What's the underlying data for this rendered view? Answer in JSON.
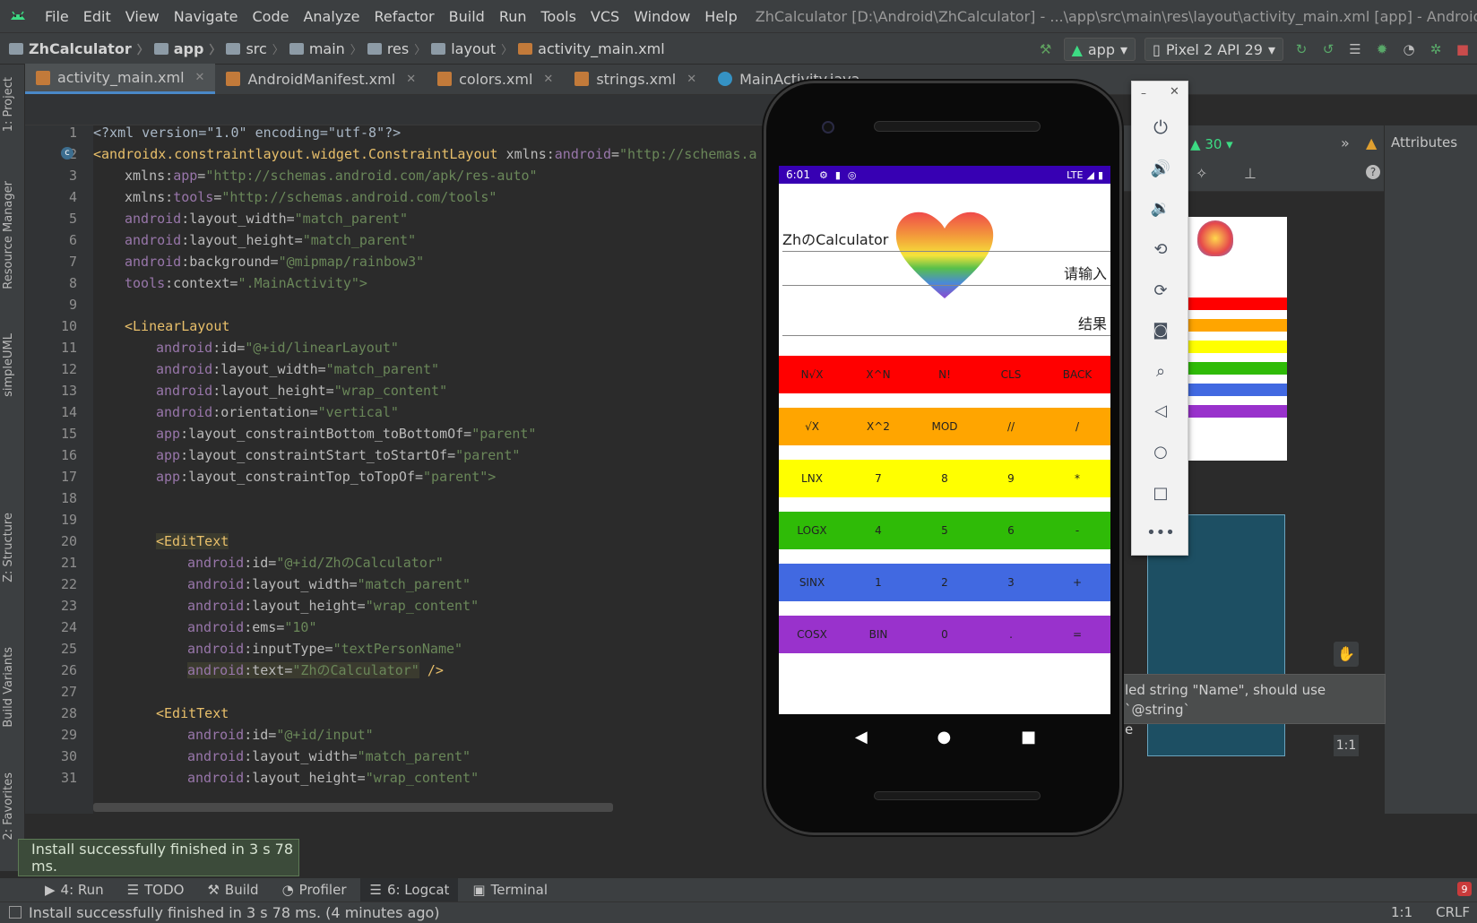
{
  "window": {
    "title": "ZhCalculator [D:\\Android\\ZhCalculator] - ...\\app\\src\\main\\res\\layout\\activity_main.xml [app] - Android Studio",
    "menu": [
      "File",
      "Edit",
      "View",
      "Navigate",
      "Code",
      "Analyze",
      "Refactor",
      "Build",
      "Run",
      "Tools",
      "VCS",
      "Window",
      "Help"
    ]
  },
  "breadcrumb": [
    "ZhCalculator",
    "app",
    "src",
    "main",
    "res",
    "layout",
    "activity_main.xml"
  ],
  "toolbar": {
    "config": "app",
    "device": "Pixel 2 API 29"
  },
  "left_tabs": [
    "1: Project",
    "Resource Manager",
    "simpleUML",
    "Z: Structure",
    "Build Variants",
    "2: Favorites"
  ],
  "tabs": [
    "activity_main.xml",
    "AndroidManifest.xml",
    "colors.xml",
    "strings.xml",
    "MainActivity.java"
  ],
  "design": {
    "api": "30",
    "attributes": "Attributes",
    "ratio": "1:1"
  },
  "tooltip": {
    "line1": "led string \"Name\", should use `@string`",
    "line2": "e"
  },
  "code": {
    "line_numbers": [
      "1",
      "2",
      "3",
      "4",
      "5",
      "6",
      "7",
      "8",
      "9",
      "10",
      "11",
      "12",
      "13",
      "14",
      "15",
      "16",
      "17",
      "18",
      "19",
      "20",
      "21",
      "22",
      "23",
      "24",
      "25",
      "26",
      "27",
      "28",
      "29",
      "30",
      "31"
    ],
    "l1": "<?xml version=\"1.0\" encoding=\"utf-8\"?>",
    "l2a": "<androidx.constraintlayout.widget.ConstraintLayout",
    "l2b": " xmlns:",
    "l2c": "android",
    "l2d": "=",
    "l2e": "\"http://schemas.a",
    "l3a": "xmlns:",
    "l3b": "app",
    "l3c": "=",
    "l3d": "\"http://schemas.android.com/apk/res-auto\"",
    "l4a": "xmlns:",
    "l4b": "tools",
    "l4c": "=",
    "l4d": "\"http://schemas.android.com/tools\"",
    "android": "android",
    "app": "app",
    "tools": "tools",
    "l5a": ":layout_width=",
    "l5b": "\"match_parent\"",
    "l6a": ":layout_height=",
    "l6b": "\"match_parent\"",
    "l7a": ":background=",
    "l7b": "\"@mipmap/rainbow3\"",
    "l8a": ":context=",
    "l8b": "\".MainActivity\">",
    "l10": "<LinearLayout",
    "l11a": ":id=",
    "l11b": "\"@+id/linearLayout\"",
    "l12a": ":layout_width=",
    "l12b": "\"match_parent\"",
    "l13a": ":layout_height=",
    "l13b": "\"wrap_content\"",
    "l14a": ":orientation=",
    "l14b": "\"vertical\"",
    "l15a": ":layout_constraintBottom_toBottomOf=",
    "l15b": "\"parent\"",
    "l16a": ":layout_constraintStart_toStartOf=",
    "l16b": "\"parent\"",
    "l17a": ":layout_constraintTop_toTopOf=",
    "l17b": "\"parent\">",
    "l20": "<EditText",
    "l21a": ":id=",
    "l21b": "\"@+id/ZhのCalculator\"",
    "l22a": ":layout_width=",
    "l22b": "\"match_parent\"",
    "l23a": ":layout_height=",
    "l23b": "\"wrap_content\"",
    "l24a": ":ems=",
    "l24b": "\"10\"",
    "l25a": ":inputType=",
    "l25b": "\"textPersonName\"",
    "l26a": ":text=",
    "l26b": "\"ZhのCalculator\"",
    "l26c": " />",
    "l28": "<EditText",
    "l29a": ":id=",
    "l29b": "\"@+id/input\"",
    "l30a": ":layout_width=",
    "l30b": "\"match_parent\"",
    "l31a": ":layout_height=",
    "l31b": "\"wrap_content\""
  },
  "phone": {
    "time": "6:01",
    "network": "LTE",
    "title_field": "ZhのCalculator",
    "input_hint": "请输入",
    "result": "结果",
    "rows": [
      {
        "color": "#ff0000",
        "keys": [
          "N√X",
          "X^N",
          "N!",
          "CLS",
          "BACK"
        ]
      },
      {
        "color": "#ffa500",
        "keys": [
          "√X",
          "X^2",
          "MOD",
          "//",
          "/"
        ]
      },
      {
        "color": "#ffff00",
        "keys": [
          "LNX",
          "7",
          "8",
          "9",
          "*"
        ]
      },
      {
        "color": "#2fbb07",
        "keys": [
          "LOGX",
          "4",
          "5",
          "6",
          "-"
        ]
      },
      {
        "color": "#4169e1",
        "keys": [
          "SINX",
          "1",
          "2",
          "3",
          "+"
        ]
      },
      {
        "color": "#9932cc",
        "keys": [
          "COSX",
          "BIN",
          "0",
          ".",
          "="
        ]
      }
    ]
  },
  "balloon": "Install successfully finished in 3 s 78 ms.",
  "bottom_tabs": {
    "run": "4: Run",
    "todo": "TODO",
    "build": "Build",
    "profiler": "Profiler",
    "logcat": "6: Logcat",
    "terminal": "Terminal"
  },
  "error_count": "9",
  "status": {
    "message": "Install successfully finished in 3 s 78 ms. (4 minutes ago)",
    "position": "1:1",
    "encoding": "CRLF"
  }
}
